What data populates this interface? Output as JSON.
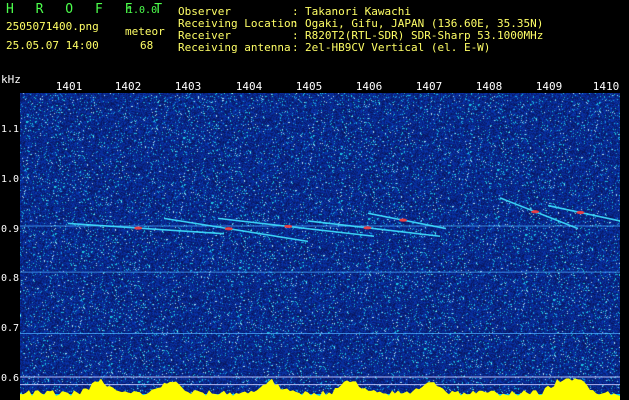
{
  "header": {
    "app_name": "H R O F F T",
    "version": "1.0.0",
    "file_name": "2505071400.png",
    "datetime": "25.05.07 14:00",
    "meteor_label": "meteor",
    "meteor_count": "68",
    "fields": [
      {
        "label": "Observer",
        "value": "Takanori Kawachi"
      },
      {
        "label": "Receiving Location",
        "value": "Ogaki, Gifu, JAPAN (136.60E, 35.35N)"
      },
      {
        "label": "Receiver",
        "value": "R820T2(RTL-SDR) SDR-Sharp 53.1000MHz"
      },
      {
        "label": "Receiving antenna",
        "value": "2el-HB9CV Vertical (el. E-W)"
      }
    ],
    "separator": ":"
  },
  "axes": {
    "y_unit": "kHz",
    "x_ticks": [
      "1401",
      "1402",
      "1403",
      "1404",
      "1405",
      "1406",
      "1407",
      "1408",
      "1409",
      "1410"
    ],
    "y_ticks": [
      "1.1",
      "1.0",
      "0.9",
      "0.8",
      "0.7",
      "0.6"
    ]
  },
  "colors": {
    "background": "#000000",
    "noise_base": "#0a1a6e",
    "trace": "#40e0ff",
    "hot": "#ff3030",
    "histogram": "#ffff00",
    "histogram_base": "#00c8ff",
    "header_text": "#ffff66",
    "title_text": "#4cff4c"
  },
  "chart_data": {
    "type": "heatmap",
    "x_axis": {
      "label": "",
      "ticks": [
        "1401",
        "1402",
        "1403",
        "1404",
        "1405",
        "1406",
        "1407",
        "1408",
        "1409",
        "1410"
      ]
    },
    "y_axis": {
      "label": "kHz",
      "range": [
        0.57,
        1.17
      ],
      "ticks": [
        1.1,
        1.0,
        0.9,
        0.8,
        0.7,
        0.6
      ]
    },
    "carrier_lines_khz": [
      0.91,
      0.82,
      0.7,
      0.615,
      0.6
    ],
    "meteor_streaks": [
      {
        "x_start": 1401.0,
        "x_end": 1403.6,
        "y_start": 0.915,
        "y_end": 0.895
      },
      {
        "x_start": 1402.6,
        "x_end": 1405.0,
        "y_start": 0.925,
        "y_end": 0.88
      },
      {
        "x_start": 1403.5,
        "x_end": 1406.1,
        "y_start": 0.925,
        "y_end": 0.89
      },
      {
        "x_start": 1405.0,
        "x_end": 1407.2,
        "y_start": 0.92,
        "y_end": 0.89
      },
      {
        "x_start": 1406.0,
        "x_end": 1407.3,
        "y_start": 0.935,
        "y_end": 0.905
      },
      {
        "x_start": 1408.2,
        "x_end": 1409.5,
        "y_start": 0.965,
        "y_end": 0.905
      },
      {
        "x_start": 1409.0,
        "x_end": 1410.2,
        "y_start": 0.95,
        "y_end": 0.92
      }
    ]
  }
}
